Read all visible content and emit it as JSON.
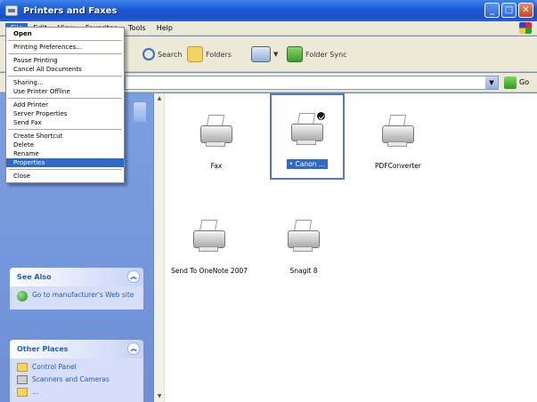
{
  "window": {
    "title": "Printers and Faxes"
  },
  "menubar": {
    "items": [
      "File",
      "Edit",
      "View",
      "Favorites",
      "Tools",
      "Help"
    ]
  },
  "toolbar": {
    "search": "Search",
    "folders": "Folders",
    "folder_sync": "Folder Sync"
  },
  "address": {
    "go_label": "Go"
  },
  "file_menu": {
    "groups": [
      [
        "Open"
      ],
      [
        "Printing Preferences..."
      ],
      [
        "Pause Printing",
        "Cancel All Documents"
      ],
      [
        "Sharing...",
        "Use Printer Offline"
      ],
      [
        "Add Printer",
        "Server Properties",
        "Send Fax"
      ],
      [
        "Create Shortcut",
        "Delete",
        "Rename",
        "Properties"
      ],
      [
        "Close"
      ]
    ],
    "highlighted": "Properties"
  },
  "see_also": {
    "title": "See Also",
    "links": [
      "Go to manufacturer's Web site"
    ]
  },
  "other_places": {
    "title": "Other Places",
    "links": [
      "Control Panel",
      "Scanners and Cameras",
      "…"
    ]
  },
  "printers": [
    {
      "name": "Fax",
      "default": false,
      "selected": false
    },
    {
      "name": "• Canon …",
      "default": true,
      "selected": true
    },
    {
      "name": "PDFConverter",
      "default": false,
      "selected": false
    },
    {
      "name": "Send To OneNote 2007",
      "default": false,
      "selected": false
    },
    {
      "name": "Snagit 8",
      "default": false,
      "selected": false
    }
  ]
}
